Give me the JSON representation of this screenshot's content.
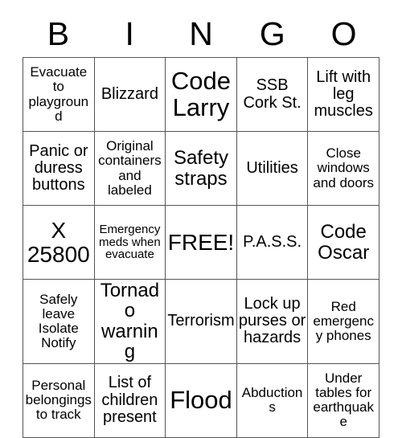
{
  "card": {
    "type": "bingo-card",
    "header_letters": [
      "B",
      "I",
      "N",
      "G",
      "O"
    ],
    "columns": 5,
    "rows": 5,
    "border_color": "#555555",
    "text_color": "#000000",
    "background_color": "#ffffff",
    "free_space": {
      "row": 3,
      "column": 3,
      "label": "FREE!"
    },
    "grid": [
      [
        {
          "text": "Evacuate to playground",
          "size": "fs-s"
        },
        {
          "text": "Blizzard",
          "size": "fs-m"
        },
        {
          "text": "Code Larry",
          "size": "fs-xxl"
        },
        {
          "text": "SSB Cork St.",
          "size": "fs-m"
        },
        {
          "text": "Lift with leg muscles",
          "size": "fs-m"
        }
      ],
      [
        {
          "text": "Panic or duress buttons",
          "size": "fs-m"
        },
        {
          "text": "Original containers and labeled",
          "size": "fs-s"
        },
        {
          "text": "Safety straps",
          "size": "fs-l"
        },
        {
          "text": "Utilities",
          "size": "fs-m"
        },
        {
          "text": "Close windows and doors",
          "size": "fs-s"
        }
      ],
      [
        {
          "text": "X 25800",
          "size": "fs-xl"
        },
        {
          "text": "Emergency meds when evacuate",
          "size": "fs-xs"
        },
        {
          "text": "FREE!",
          "size": "fs-xl"
        },
        {
          "text": "P.A.S.S.",
          "size": "fs-m"
        },
        {
          "text": "Code Oscar",
          "size": "fs-l"
        }
      ],
      [
        {
          "text": "Safely leave Isolate Notify",
          "size": "fs-s"
        },
        {
          "text": "Tornado warning",
          "size": "fs-l"
        },
        {
          "text": "Terrorism",
          "size": "fs-m"
        },
        {
          "text": "Lock up purses or hazards",
          "size": "fs-m"
        },
        {
          "text": "Red emergency phones",
          "size": "fs-s"
        }
      ],
      [
        {
          "text": "Personal belongings to track",
          "size": "fs-s"
        },
        {
          "text": "List of children present",
          "size": "fs-m"
        },
        {
          "text": "Flood",
          "size": "fs-xxl"
        },
        {
          "text": "Abductions",
          "size": "fs-s"
        },
        {
          "text": "Under tables for earthquake",
          "size": "fs-s"
        }
      ]
    ]
  }
}
